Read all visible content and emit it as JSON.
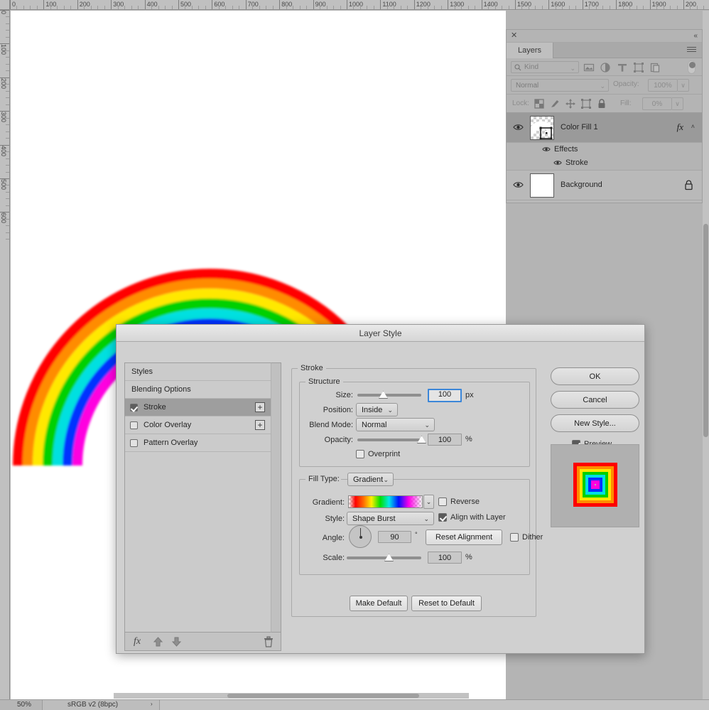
{
  "app": {
    "ruler_top_labels": [
      "0",
      "100",
      "200",
      "300",
      "400",
      "500",
      "600",
      "700",
      "800",
      "900",
      "1000",
      "1100",
      "1200",
      "1300",
      "1400",
      "1500",
      "1600",
      "1700",
      "1800",
      "1900",
      "200"
    ],
    "ruler_left_labels": [
      "0",
      "100",
      "200",
      "300",
      "400",
      "500",
      "600"
    ]
  },
  "statusbar": {
    "zoom": "50%",
    "doc_info": "sRGB v2 (8bpc)",
    "arrow": "›"
  },
  "layers_panel": {
    "close_label": "✕",
    "collapse_label": "«",
    "tab_label": "Layers",
    "menu_icon": "panel-menu-icon",
    "filter": {
      "kind_label": "Kind",
      "search_icon": "search-icon",
      "icons": [
        "pixel-layer-filter-icon",
        "adjustment-layer-filter-icon",
        "type-layer-filter-icon",
        "shape-layer-filter-icon",
        "smart-object-filter-icon"
      ],
      "toggle_icon": "filter-enable-toggle"
    },
    "blend": {
      "mode": "Normal",
      "opacity_label": "Opacity:",
      "opacity_value": "100%",
      "caret": "∨"
    },
    "lock": {
      "label": "Lock:",
      "icons": [
        "lock-transparent-pixels-icon",
        "lock-image-pixels-icon",
        "lock-position-icon",
        "lock-artboard-nesting-icon",
        "lock-all-icon"
      ],
      "fill_label": "Fill:",
      "fill_value": "0%",
      "caret": "∨"
    },
    "layers": [
      {
        "name": "Color Fill 1",
        "visible": true,
        "selected": true,
        "fx_label": "fx",
        "chevron": "˄",
        "effects_group_label": "Effects",
        "effects": [
          "Stroke"
        ]
      },
      {
        "name": "Background",
        "visible": true,
        "selected": false,
        "locked": true
      }
    ]
  },
  "dialog": {
    "title": "Layer Style",
    "styles_list": [
      {
        "label": "Styles",
        "checkbox": null,
        "plus": false,
        "selected": false
      },
      {
        "label": "Blending Options",
        "checkbox": null,
        "plus": false,
        "selected": false
      },
      {
        "label": "Stroke",
        "checkbox": true,
        "plus": true,
        "selected": true
      },
      {
        "label": "Color Overlay",
        "checkbox": false,
        "plus": true,
        "selected": false
      },
      {
        "label": "Pattern Overlay",
        "checkbox": false,
        "plus": false,
        "selected": false
      }
    ],
    "styles_footer_icons": [
      "fx-add-icon",
      "move-up-icon",
      "move-down-icon",
      "delete-trash-icon"
    ],
    "stroke_group_label": "Stroke",
    "structure": {
      "legend": "Structure",
      "size_label": "Size:",
      "size_value": "100",
      "size_unit": "px",
      "size_slider_pct": 36,
      "position_label": "Position:",
      "position_value": "Inside",
      "blend_mode_label": "Blend Mode:",
      "blend_mode_value": "Normal",
      "opacity_label": "Opacity:",
      "opacity_value": "100",
      "opacity_unit": "%",
      "opacity_slider_pct": 100,
      "overprint_label": "Overprint",
      "overprint_checked": false
    },
    "fill_type": {
      "legend": "Fill Type:",
      "value": "Gradient",
      "gradient_label": "Gradient:",
      "gradient_name": "spectrum-transparent-gradient",
      "reverse_label": "Reverse",
      "reverse_checked": false,
      "style_label": "Style:",
      "style_value": "Shape Burst",
      "align_label": "Align with Layer",
      "align_checked": true,
      "angle_label": "Angle:",
      "angle_value": "90",
      "angle_unit": "°",
      "reset_alignment_label": "Reset Alignment",
      "dither_label": "Dither",
      "dither_checked": false,
      "scale_label": "Scale:",
      "scale_value": "100",
      "scale_unit": "%",
      "scale_slider_pct": 50
    },
    "footer_buttons": {
      "make_default": "Make Default",
      "reset_to_default": "Reset to Default"
    },
    "right_buttons": {
      "ok": "OK",
      "cancel": "Cancel",
      "new_style": "New Style...",
      "preview_label": "Preview",
      "preview_checked": true
    }
  },
  "colors": {
    "accent_focus": "#3b86d8",
    "dialog_bg": "#d0d0d0",
    "panel_bg": "#b4b4b4",
    "selected_row": "#9a9a9a",
    "rainbow": [
      "#ff0000",
      "#ff8c00",
      "#ffe800",
      "#00d000",
      "#00e0e0",
      "#0030ff",
      "#ff00e0"
    ]
  }
}
